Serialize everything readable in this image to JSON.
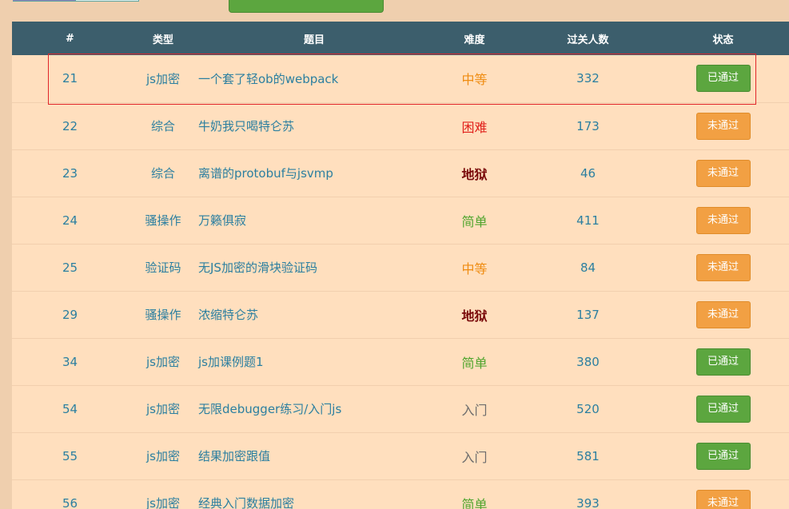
{
  "table": {
    "headers": [
      "#",
      "类型",
      "题目",
      "难度",
      "过关人数",
      "状态"
    ],
    "rows": [
      {
        "id": "21",
        "type": "js加密",
        "title": "一个套了轻ob的webpack",
        "difficulty": "中等",
        "diff_class": "medium",
        "passed": "332",
        "status": "已通过",
        "status_class": "pass"
      },
      {
        "id": "22",
        "type": "综合",
        "title": "牛奶我只喝特仑苏",
        "difficulty": "困难",
        "diff_class": "hard",
        "passed": "173",
        "status": "未通过",
        "status_class": "fail"
      },
      {
        "id": "23",
        "type": "综合",
        "title": "离谱的protobuf与jsvmp",
        "difficulty": "地狱",
        "diff_class": "hell",
        "passed": "46",
        "status": "未通过",
        "status_class": "fail"
      },
      {
        "id": "24",
        "type": "骚操作",
        "title": "万籁俱寂",
        "difficulty": "简单",
        "diff_class": "easy",
        "passed": "411",
        "status": "未通过",
        "status_class": "fail"
      },
      {
        "id": "25",
        "type": "验证码",
        "title": "无JS加密的滑块验证码",
        "difficulty": "中等",
        "diff_class": "medium",
        "passed": "84",
        "status": "未通过",
        "status_class": "fail"
      },
      {
        "id": "29",
        "type": "骚操作",
        "title": "浓缩特仑苏",
        "difficulty": "地狱",
        "diff_class": "hell",
        "passed": "137",
        "status": "未通过",
        "status_class": "fail"
      },
      {
        "id": "34",
        "type": "js加密",
        "title": "js加课例题1",
        "difficulty": "简单",
        "diff_class": "easy",
        "passed": "380",
        "status": "已通过",
        "status_class": "pass"
      },
      {
        "id": "54",
        "type": "js加密",
        "title": "无限debugger练习/入门js",
        "difficulty": "入门",
        "diff_class": "intro",
        "passed": "520",
        "status": "已通过",
        "status_class": "pass"
      },
      {
        "id": "55",
        "type": "js加密",
        "title": "结果加密跟值",
        "difficulty": "入门",
        "diff_class": "intro",
        "passed": "581",
        "status": "已通过",
        "status_class": "pass"
      },
      {
        "id": "56",
        "type": "js加密",
        "title": "经典入门数据加密",
        "difficulty": "简单",
        "diff_class": "easy",
        "passed": "393",
        "status": "未通过",
        "status_class": "fail"
      }
    ]
  },
  "colors": {
    "header_bg": "#3c5e6c",
    "row_bg": "#ffdfbe",
    "page_bg": "#efcfae",
    "pass": "#5ca63f",
    "fail": "#f2a043",
    "highlight": "#e0262a"
  }
}
